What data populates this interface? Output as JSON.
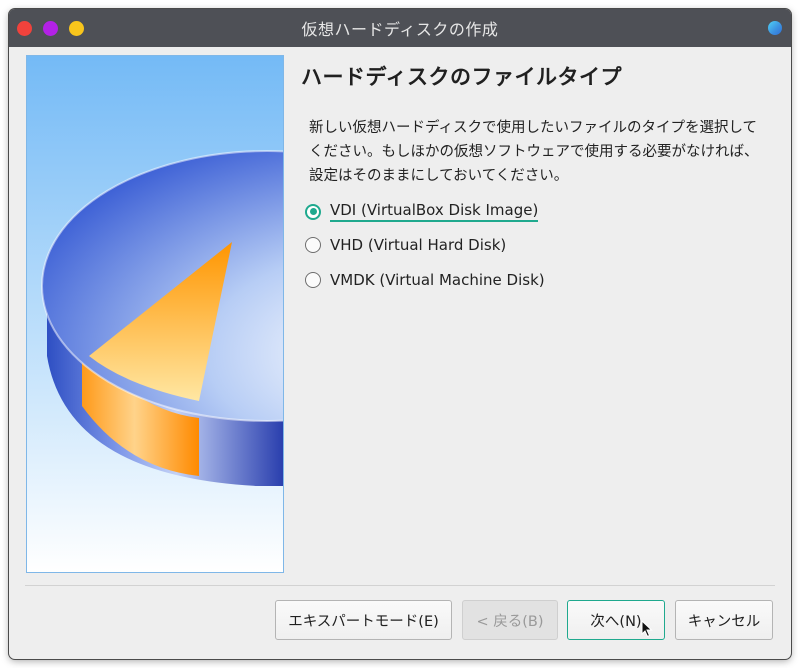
{
  "window": {
    "title": "仮想ハードディスクの作成"
  },
  "main": {
    "heading": "ハードディスクのファイルタイプ",
    "description": "新しい仮想ハードディスクで使用したいファイルのタイプを選択してください。もしほかの仮想ソフトウェアで使用する必要がなければ、設定はそのままにしておいてください。",
    "options": [
      {
        "label": "VDI (VirtualBox Disk Image)",
        "checked": true
      },
      {
        "label": "VHD (Virtual Hard Disk)",
        "checked": false
      },
      {
        "label": "VMDK (Virtual Machine Disk)",
        "checked": false
      }
    ]
  },
  "buttons": {
    "expert": "エキスパートモード(E)",
    "back": "< 戻る(B)",
    "next": "次へ(N)",
    "cancel": "キャンセル"
  },
  "colors": {
    "accent": "#1fa98e",
    "titlebar": "#4e5056",
    "close": "#f0423c",
    "minimize": "#b321e6",
    "maximize": "#f8c51c"
  }
}
